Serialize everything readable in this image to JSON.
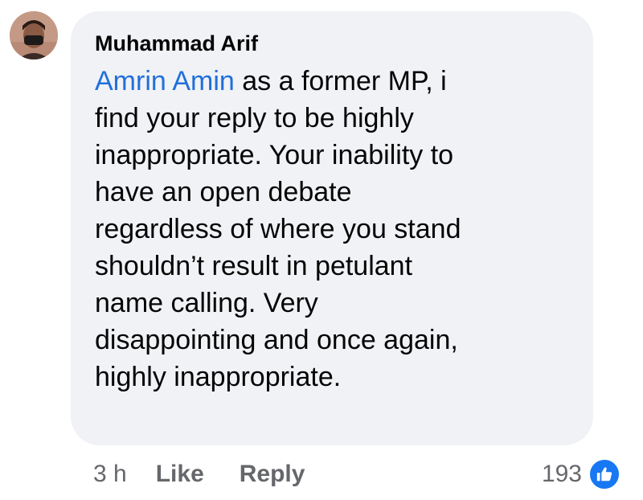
{
  "comment": {
    "author": "Muhammad Arif",
    "mention": "Amrin Amin",
    "lines": [
      " as a former MP, i",
      "find your reply to be highly",
      "inappropriate. Your inability to",
      "have an open debate",
      "regardless of where you stand",
      "shouldn’t result in petulant",
      "name calling. Very",
      "disappointing and once again,",
      "highly inappropriate."
    ]
  },
  "actions": {
    "time": "3 h",
    "like_label": "Like",
    "reply_label": "Reply"
  },
  "reactions": {
    "count": "193",
    "icon": "thumbs-up-icon"
  },
  "colors": {
    "bubble": "#f0f2f5",
    "mention": "#216fdb",
    "muted": "#65676b",
    "like_badge": "#1877f2"
  }
}
